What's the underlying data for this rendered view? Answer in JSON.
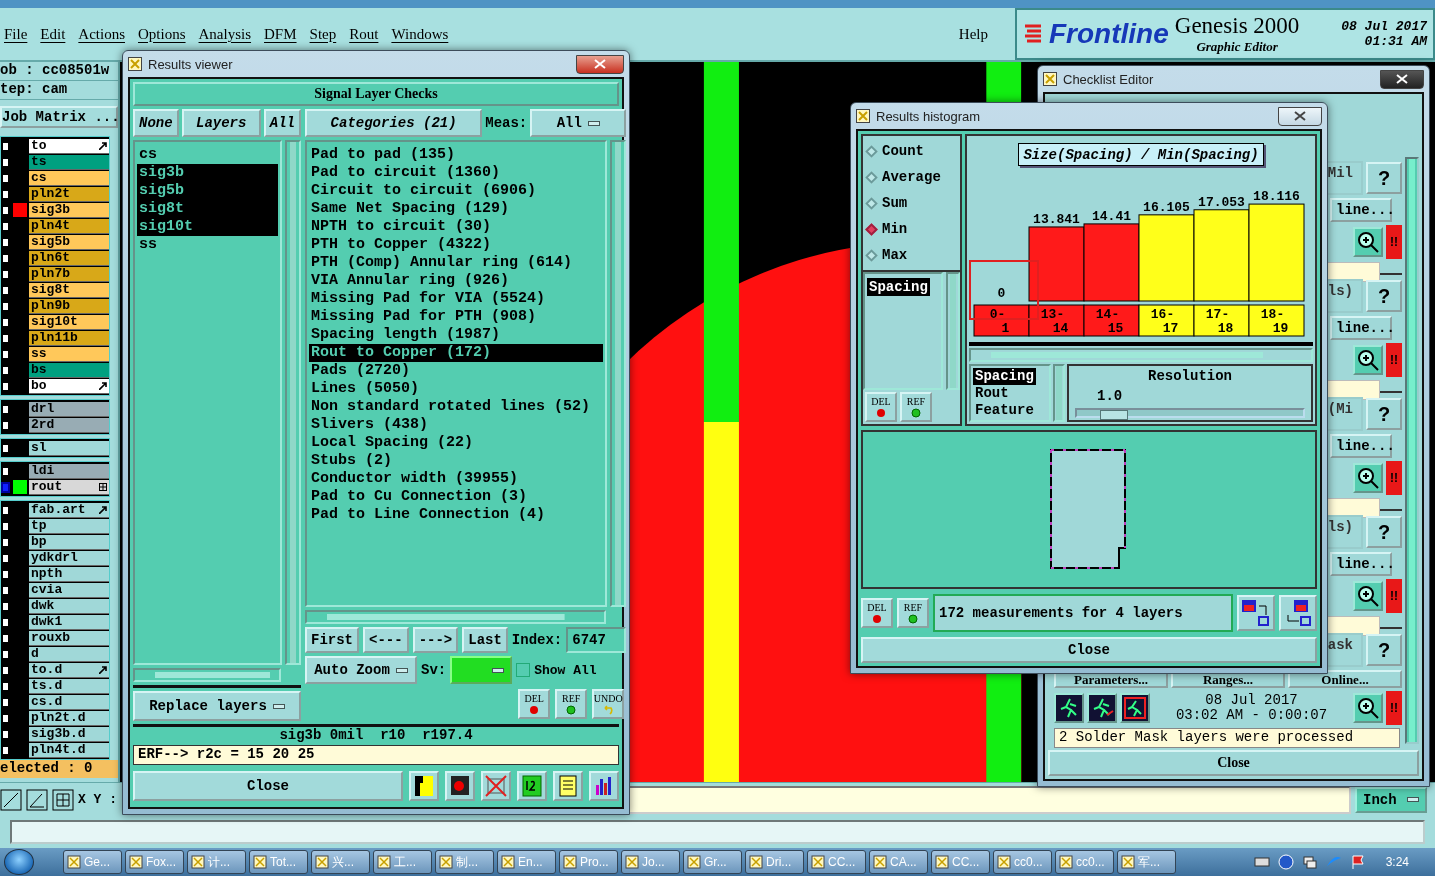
{
  "menu": {
    "items": [
      {
        "label": "File"
      },
      {
        "label": "Edit"
      },
      {
        "label": "Actions"
      },
      {
        "label": "Options"
      },
      {
        "label": "Analysis"
      },
      {
        "label": "DFM"
      },
      {
        "label": "Step"
      },
      {
        "label": "Rout"
      },
      {
        "label": "Windows"
      }
    ],
    "help": "Help"
  },
  "brand": {
    "logo": "Frontline",
    "product": "Genesis 2000",
    "subtitle": "Graphic Editor",
    "date": "08 Jul 2017",
    "time": "01:31 AM"
  },
  "job_panel": {
    "job": "ob : cc08501w",
    "step": "tep: cam",
    "matrix_button": "Job Matrix ...",
    "selected_count": "elected : 0",
    "coords_label": "X Y :",
    "groups": [
      {
        "layers": [
          {
            "name": "to",
            "color": "#ffffff",
            "kind": "arrow",
            "active": false
          },
          {
            "name": "ts",
            "color": "#00a080",
            "active": false
          },
          {
            "name": "cs",
            "color": "#ffc85a",
            "active": false
          },
          {
            "name": "pln2t",
            "color": "#d8a818",
            "active": false
          },
          {
            "name": "sig3b",
            "color": "#ffc85a",
            "swatch": {
              "color": "#ff0000"
            },
            "active": false
          },
          {
            "name": "pln4t",
            "color": "#d8a818",
            "active": false
          },
          {
            "name": "sig5b",
            "color": "#ffc85a",
            "active": false
          },
          {
            "name": "pln6t",
            "color": "#d8a818",
            "active": false
          },
          {
            "name": "pln7b",
            "color": "#d8a818",
            "active": false
          },
          {
            "name": "sig8t",
            "color": "#ffc85a",
            "active": false
          },
          {
            "name": "pln9b",
            "color": "#d8a818",
            "active": false
          },
          {
            "name": "sig10t",
            "color": "#ffc85a",
            "active": false
          },
          {
            "name": "pln11b",
            "color": "#d8a818",
            "active": false
          },
          {
            "name": "ss",
            "color": "#ffc85a",
            "active": false
          },
          {
            "name": "bs",
            "color": "#00a080",
            "active": false
          },
          {
            "name": "bo",
            "color": "#ffffff",
            "kind": "arrow",
            "active": false
          }
        ]
      },
      {
        "layers": [
          {
            "name": "drl",
            "color": "#98acb4",
            "active": false
          },
          {
            "name": "2rd",
            "color": "#98acb4",
            "active": false
          }
        ]
      },
      {
        "layers": [
          {
            "name": "sl",
            "color": "#a0d8d8",
            "active": false
          }
        ]
      },
      {
        "layers": [
          {
            "name": "ldi",
            "color": "#98acb4",
            "active": false
          },
          {
            "name": "rout",
            "color": "#d8d8d8",
            "swatch": {
              "color": "#00ff00"
            },
            "kind": "grid",
            "active": true
          }
        ]
      },
      {
        "layers": [
          {
            "name": "fab.art",
            "color": "#a0d8d8",
            "kind": "arrow",
            "active": false
          },
          {
            "name": "tp",
            "color": "#a0d8d8",
            "active": false
          },
          {
            "name": "bp",
            "color": "#a0d8d8",
            "active": false
          },
          {
            "name": "ydkdrl",
            "color": "#a0d8d8",
            "active": false
          },
          {
            "name": "npth",
            "color": "#a0d8d8",
            "active": false
          },
          {
            "name": "cvia",
            "color": "#a0d8d8",
            "active": false
          },
          {
            "name": "dwk",
            "color": "#a0d8d8",
            "active": false
          },
          {
            "name": "dwk1",
            "color": "#a0d8d8",
            "active": false
          },
          {
            "name": "rouxb",
            "color": "#a0d8d8",
            "active": false
          },
          {
            "name": "d",
            "color": "#a0d8d8",
            "active": false
          },
          {
            "name": "to.d",
            "color": "#a0d8d8",
            "kind": "arrow",
            "active": false
          },
          {
            "name": "ts.d",
            "color": "#a0d8d8",
            "active": false
          },
          {
            "name": "cs.d",
            "color": "#a0d8d8",
            "active": false
          },
          {
            "name": "pln2t.d",
            "color": "#a0d8d8",
            "active": false
          },
          {
            "name": "sig3b.d",
            "color": "#a0d8d8",
            "active": false
          },
          {
            "name": "pln4t.d",
            "color": "#a0d8d8",
            "active": false
          }
        ]
      }
    ]
  },
  "status_bar": {
    "units": "Inch"
  },
  "results_viewer": {
    "title": "Results viewer",
    "header": "Signal Layer Checks",
    "layer_buttons": [
      "None",
      "Layers",
      "All"
    ],
    "layers": [
      {
        "label": "cs",
        "selected": false
      },
      {
        "label": "sig3b",
        "selected": true
      },
      {
        "label": "sig5b",
        "selected": true
      },
      {
        "label": "sig8t",
        "selected": true
      },
      {
        "label": "sig10t",
        "selected": true
      },
      {
        "label": "ss",
        "selected": false
      }
    ],
    "categories_button": "Categories (21)",
    "meas_label": "Meas:",
    "meas_value": "All",
    "categories": [
      {
        "label": "Pad to pad (135)",
        "selected": false
      },
      {
        "label": "Pad to circuit (1360)",
        "selected": false
      },
      {
        "label": "Circuit to circuit (6906)",
        "selected": false
      },
      {
        "label": "Same Net Spacing (129)",
        "selected": false
      },
      {
        "label": "NPTH to circuit (30)",
        "selected": false
      },
      {
        "label": "PTH to Copper (4322)",
        "selected": false
      },
      {
        "label": "PTH (Comp) Annular ring (614)",
        "selected": false
      },
      {
        "label": "VIA Annular ring (926)",
        "selected": false
      },
      {
        "label": "Missing Pad for VIA (5524)",
        "selected": false
      },
      {
        "label": "Missing Pad for PTH (908)",
        "selected": false
      },
      {
        "label": "Spacing length (1987)",
        "selected": false
      },
      {
        "label": "Rout to Copper (172)",
        "selected": true
      },
      {
        "label": "Pads (2720)",
        "selected": false
      },
      {
        "label": "Lines (5050)",
        "selected": false
      },
      {
        "label": "Non standard rotated lines (52)",
        "selected": false
      },
      {
        "label": "Slivers (438)",
        "selected": false
      },
      {
        "label": "Local Spacing (22)",
        "selected": false
      },
      {
        "label": "Stubs (2)",
        "selected": false
      },
      {
        "label": "Conductor width (39955)",
        "selected": false
      },
      {
        "label": "Pad to Cu Connection (3)",
        "selected": false
      },
      {
        "label": "Pad to Line Connection (4)",
        "selected": false
      }
    ],
    "nav_buttons": [
      "First",
      "<---",
      "--->",
      "Last"
    ],
    "index_label": "Index:",
    "index_value": "6747",
    "zoom_mode": "Auto Zoom",
    "sv_label": "Sv:",
    "sv": {
      "color": "#22dd22"
    },
    "show_all": {
      "label": "Show All",
      "checked": false
    },
    "replace_mode": "Replace layers",
    "icon_buttons": [
      {
        "label": "DEL",
        "kind": "delete"
      },
      {
        "label": "REF",
        "kind": "refresh"
      },
      {
        "label": "UNDO",
        "kind": "undo"
      }
    ],
    "info": "sig3b 0mil  r10  r197.4",
    "erf": "ERF--> r2c = 15 20 25",
    "close": "Close"
  },
  "histogram": {
    "title": "Results histogram",
    "modes": [
      {
        "label": "Count",
        "selected": false
      },
      {
        "label": "Average",
        "selected": false
      },
      {
        "label": "Sum",
        "selected": false
      },
      {
        "label": "Min",
        "selected": true
      },
      {
        "label": "Max",
        "selected": false
      }
    ],
    "fields": [
      {
        "label": "Spacing",
        "selected": true
      }
    ],
    "icon_buttons": [
      {
        "label": "DEL",
        "kind": "delete"
      },
      {
        "label": "REF",
        "kind": "refresh"
      }
    ],
    "chart_data": {
      "type": "bar",
      "title": "Size(Spacing) / Min(Spacing)",
      "categories": [
        "0-1",
        "13-14",
        "14-15",
        "16-17",
        "17-18",
        "18-19"
      ],
      "values": [
        0,
        13.841,
        14.41,
        16.105,
        17.053,
        18.116
      ],
      "data_labels": true
    },
    "bins": [
      {
        "color": "#ff1a1a"
      },
      {
        "color": "#ff1a1a"
      },
      {
        "color": "#ff1a1a"
      },
      {
        "color": "#ffff1a"
      },
      {
        "color": "#ffff1a"
      },
      {
        "color": "#ffff1a"
      }
    ],
    "attributes": [
      {
        "label": "Spacing",
        "selected": true
      },
      {
        "label": "Rout",
        "selected": false
      },
      {
        "label": "Feature",
        "selected": false
      }
    ],
    "resolution_label": "Resolution",
    "resolution_value": "1.0",
    "resolution": {
      "level": 0.1
    },
    "footer_buttons": [
      {
        "label": "DEL",
        "kind": "delete"
      },
      {
        "label": "REF",
        "kind": "refresh"
      }
    ],
    "message": "172 measurements for 4 layers",
    "close": "Close"
  },
  "checklist_editor": {
    "title": "Checklist Editor",
    "checks": [
      {
        "label": "Mil",
        "help": "?",
        "action": "line...",
        "alert": "!!"
      },
      {
        "label": "ls)",
        "help": "?",
        "action": "line...",
        "alert": "!!"
      },
      {
        "label": "(Mi",
        "help": "?",
        "action": "line...",
        "alert": "!!"
      },
      {
        "label": "ls)",
        "help": "?",
        "action": "line...",
        "alert": "!!"
      }
    ],
    "last_check": {
      "label": "ask",
      "help": "?",
      "buttons": [
        "Parameters...",
        "Ranges...",
        "Online..."
      ],
      "date": "08 Jul 2017",
      "duration": "03:02 AM - 0:00:07",
      "alert": "!!",
      "message": "2 Solder Mask layers were processed"
    },
    "close": "Close"
  },
  "taskbar": {
    "items": [
      {
        "label": "Ge..."
      },
      {
        "label": "Fox..."
      },
      {
        "label": "计..."
      },
      {
        "label": "Tot..."
      },
      {
        "label": "兴..."
      },
      {
        "label": "工..."
      },
      {
        "label": "制..."
      },
      {
        "label": "En..."
      },
      {
        "label": "Pro..."
      },
      {
        "label": "Jo..."
      },
      {
        "label": "Gr..."
      },
      {
        "label": "Dri..."
      },
      {
        "label": "CC..."
      },
      {
        "label": "CA..."
      },
      {
        "label": "CC..."
      },
      {
        "label": "cc0..."
      },
      {
        "label": "cc0..."
      },
      {
        "label": "军..."
      }
    ],
    "clock": "3:24"
  }
}
